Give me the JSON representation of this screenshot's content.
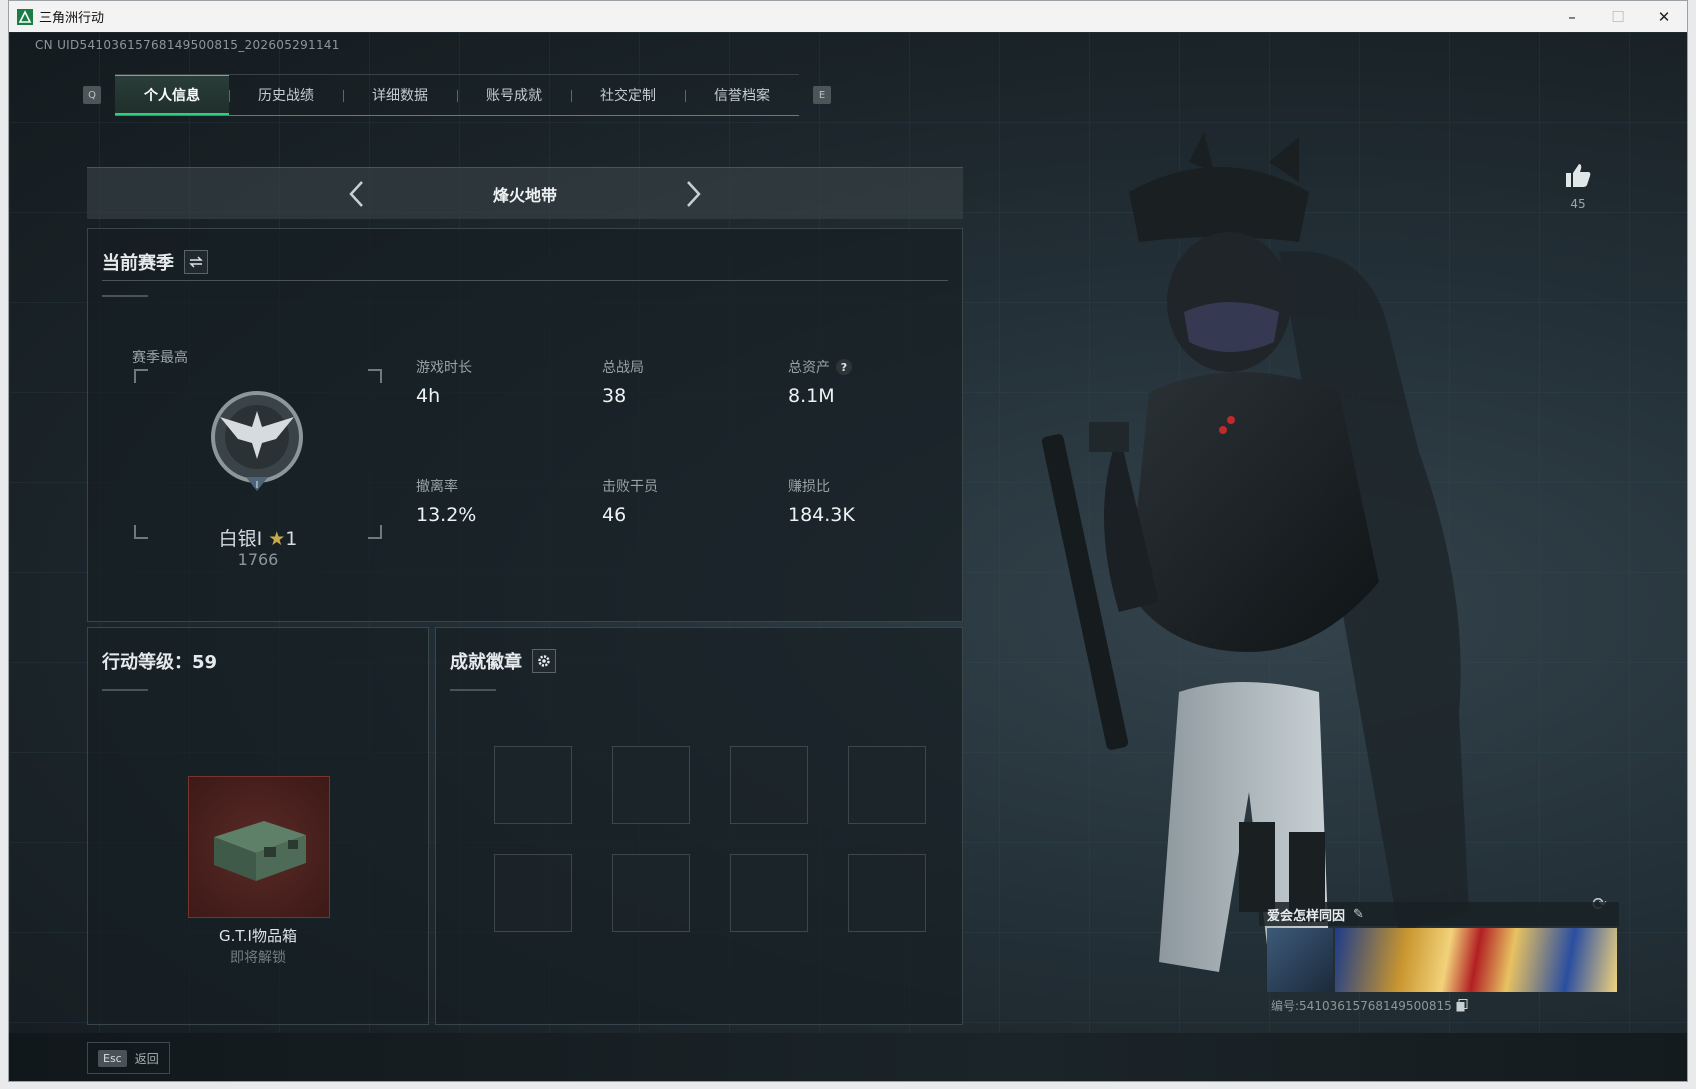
{
  "window": {
    "title": "三角洲行动"
  },
  "header": {
    "uid": "CN UID5410361576814950081​5_202605291141"
  },
  "tabs": {
    "left_key": "Q",
    "right_key": "E",
    "items": [
      {
        "label": "个人信息",
        "active": true
      },
      {
        "label": "历史战绩",
        "active": false
      },
      {
        "label": "详细数据",
        "active": false
      },
      {
        "label": "账号成就",
        "active": false
      },
      {
        "label": "社交定制",
        "active": false
      },
      {
        "label": "信誉档案",
        "active": false
      }
    ]
  },
  "mode": {
    "name": "烽火地带"
  },
  "season": {
    "title": "当前赛季",
    "best_label": "赛季最高",
    "rank_name": "白银I",
    "rank_stars": "1",
    "rank_score": "1766",
    "stats": [
      {
        "label": "游戏时长",
        "value": "4h"
      },
      {
        "label": "总战局",
        "value": "38"
      },
      {
        "label": "总资产",
        "value": "8.1M",
        "help": "?"
      },
      {
        "label": "撤离率",
        "value": "13.2%"
      },
      {
        "label": "击败干员",
        "value": "46"
      },
      {
        "label": "赚损比",
        "value": "184.3K"
      }
    ]
  },
  "level": {
    "title": "行动等级：59",
    "item_name": "G.T.I物品箱",
    "item_status": "即将解锁"
  },
  "badges": {
    "title": "成就徽章"
  },
  "profile": {
    "likes": "45",
    "nickname": "爱会怎样同因",
    "uid_line": "编号:5410361576814950081​5"
  },
  "footer": {
    "esc_key": "Esc",
    "esc_label": "返回"
  },
  "colors": {
    "accent": "#2bd07c",
    "item_bg": "#4a201d"
  }
}
